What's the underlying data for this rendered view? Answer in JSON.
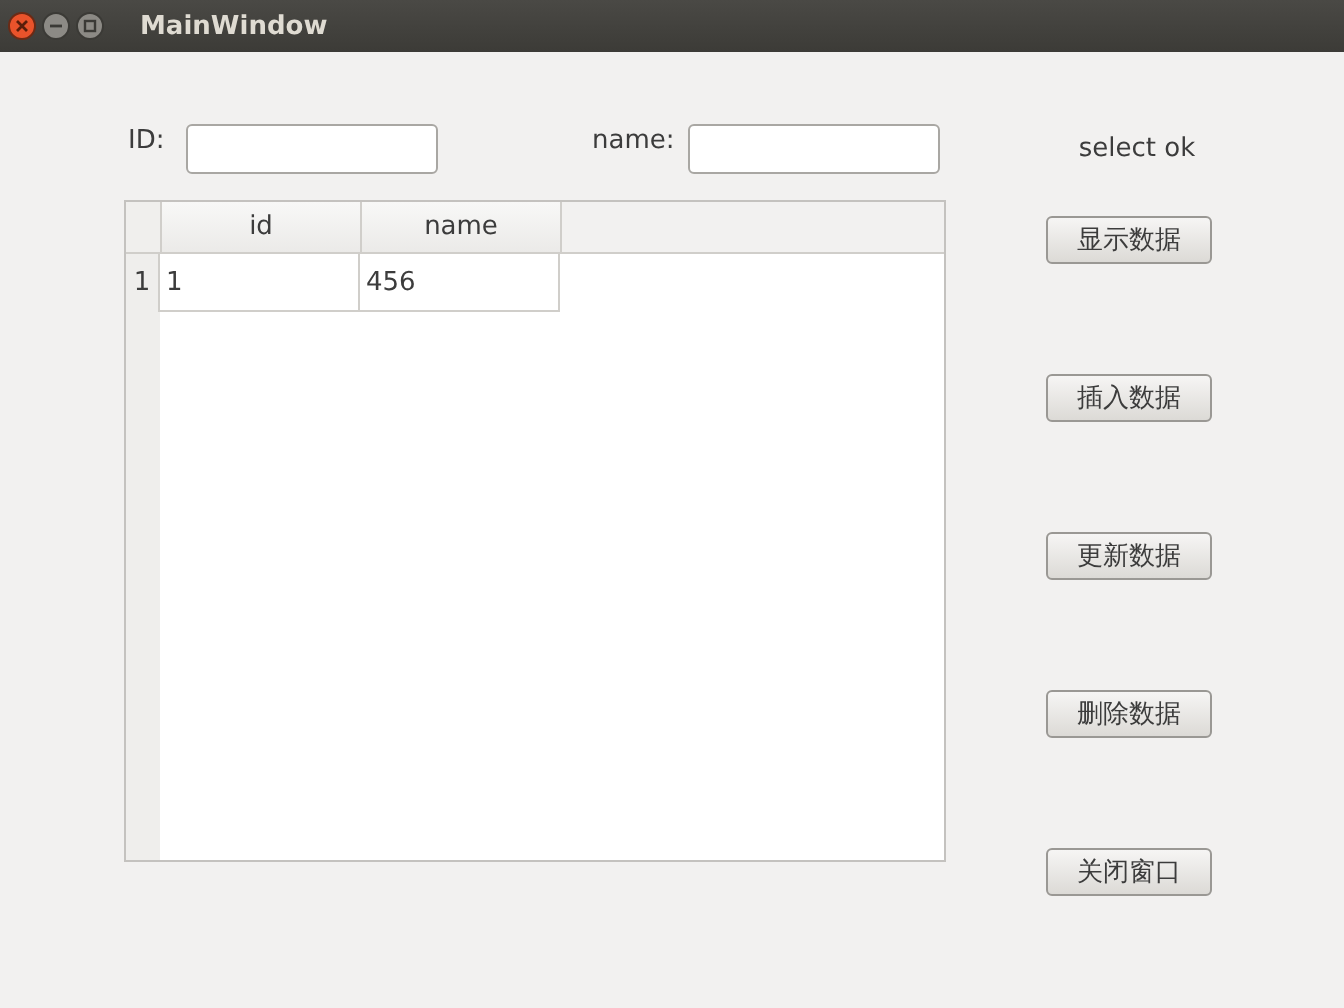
{
  "window": {
    "title": "MainWindow"
  },
  "fields": [
    {
      "label": "ID:"
    },
    {
      "label": "name:"
    }
  ],
  "status": "select ok",
  "table": {
    "columns": [
      "id",
      "name"
    ],
    "rows": [
      {
        "header": "1",
        "cells": [
          "1",
          "456"
        ]
      }
    ]
  },
  "buttons": [
    "显示数据",
    "插入数据",
    "更新数据",
    "删除数据",
    "关闭窗口"
  ]
}
